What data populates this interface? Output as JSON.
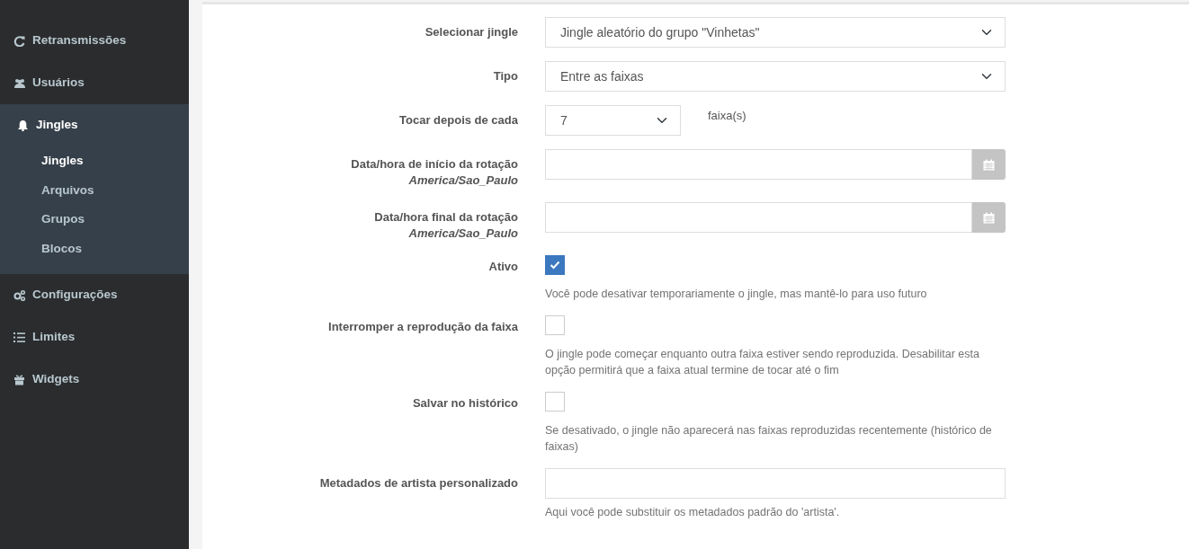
{
  "sidebar": {
    "items": [
      {
        "label": "Retransmissões",
        "expanded": false
      },
      {
        "label": "Usuários",
        "expanded": false
      },
      {
        "label": "Jingles",
        "expanded": true,
        "children": [
          {
            "label": "Jingles",
            "selected": true
          },
          {
            "label": "Arquivos",
            "selected": false
          },
          {
            "label": "Grupos",
            "selected": false
          },
          {
            "label": "Blocos",
            "selected": false
          }
        ]
      },
      {
        "label": "Configurações",
        "expanded": false
      },
      {
        "label": "Limites",
        "expanded": false
      },
      {
        "label": "Widgets",
        "expanded": false
      }
    ]
  },
  "form": {
    "fields": [
      {
        "kind": "select",
        "label": "Selecionar jingle",
        "value": "Jingle aleatório do grupo \"Vinhetas\""
      },
      {
        "kind": "select",
        "label": "Tipo",
        "value": "Entre as faixas"
      },
      {
        "kind": "select_short",
        "label": "Tocar depois de cada",
        "value": "7",
        "suffix": "faixa(s)"
      },
      {
        "kind": "datetime",
        "label": "Data/hora de início da rotação",
        "timezone": "America/Sao_Paulo"
      },
      {
        "kind": "datetime",
        "label": "Data/hora final da rotação",
        "timezone": "America/Sao_Paulo"
      },
      {
        "kind": "checkbox",
        "label": "Ativo",
        "checked": true,
        "help": "Você pode desativar temporariamente o jingle, mas mantê-lo para uso futuro"
      },
      {
        "kind": "checkbox",
        "label": "Interromper a reprodução da faixa",
        "checked": false,
        "help": "O jingle pode começar enquanto outra faixa estiver sendo reproduzida. Desabilitar esta opção permitirá que a faixa atual termine de tocar até o fim"
      },
      {
        "kind": "checkbox",
        "label": "Salvar no histórico",
        "checked": false,
        "help": "Se desativado, o jingle não aparecerá nas faixas reproduzidas recentemente (histórico de faixas)"
      },
      {
        "kind": "text",
        "label": "Metadados de artista personalizado",
        "help": "Aqui você pode substituir os metadados padrão do 'artista'."
      }
    ]
  }
}
